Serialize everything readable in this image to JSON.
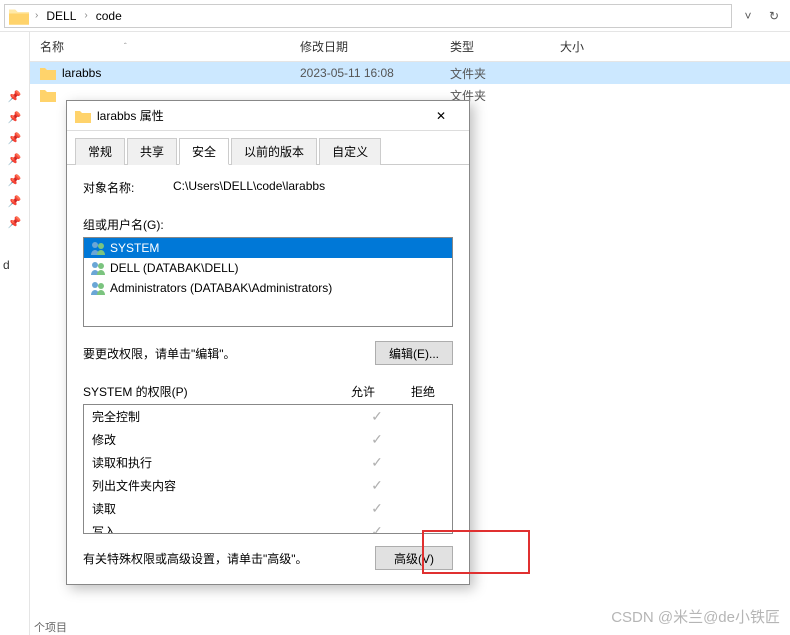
{
  "breadcrumb": {
    "segments": [
      "DELL",
      "code"
    ]
  },
  "columns": {
    "name": "名称",
    "date": "修改日期",
    "type": "类型",
    "size": "大小"
  },
  "rows": [
    {
      "name": "larabbs",
      "date": "2023-05-11 16:08",
      "type": "文件夹",
      "selected": true
    },
    {
      "name": "",
      "date": "",
      "type": "文件夹",
      "selected": false
    }
  ],
  "footer": {
    "items": "个项目"
  },
  "sidebar": {
    "letter": "d"
  },
  "dialog": {
    "title": "larabbs 属性",
    "tabs": [
      "常规",
      "共享",
      "安全",
      "以前的版本",
      "自定义"
    ],
    "active_tab": 2,
    "object_name_label": "对象名称:",
    "object_name_value": "C:\\Users\\DELL\\code\\larabbs",
    "users_label": "组或用户名(G):",
    "users": [
      {
        "name": "SYSTEM",
        "selected": true
      },
      {
        "name": "DELL (DATABAK\\DELL)",
        "selected": false
      },
      {
        "name": "Administrators (DATABAK\\Administrators)",
        "selected": false
      }
    ],
    "edit_hint": "要更改权限，请单击\"编辑\"。",
    "edit_button": "编辑(E)...",
    "perm_header": "SYSTEM 的权限(P)",
    "perm_allow": "允许",
    "perm_deny": "拒绝",
    "permissions": [
      {
        "name": "完全控制",
        "allow": true,
        "deny": false
      },
      {
        "name": "修改",
        "allow": true,
        "deny": false
      },
      {
        "name": "读取和执行",
        "allow": true,
        "deny": false
      },
      {
        "name": "列出文件夹内容",
        "allow": true,
        "deny": false
      },
      {
        "name": "读取",
        "allow": true,
        "deny": false
      },
      {
        "name": "写入",
        "allow": true,
        "deny": false
      }
    ],
    "adv_hint": "有关特殊权限或高级设置，请单击\"高级\"。",
    "adv_button": "高级(V)"
  },
  "watermark": "CSDN @米兰@de小铁匠"
}
